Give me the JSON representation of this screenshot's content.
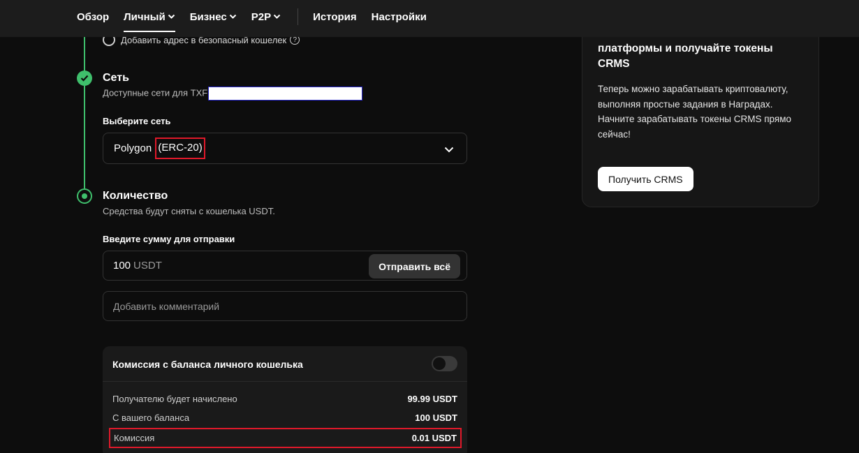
{
  "nav": {
    "items": [
      {
        "label": "Обзор",
        "dropdown": false,
        "active": false
      },
      {
        "label": "Личный",
        "dropdown": true,
        "active": true
      },
      {
        "label": "Бизнес",
        "dropdown": true,
        "active": false
      },
      {
        "label": "P2P",
        "dropdown": true,
        "active": false
      }
    ],
    "secondary": [
      {
        "label": "История"
      },
      {
        "label": "Настройки"
      }
    ]
  },
  "prev_option": {
    "label": "Добавить адрес в безопасный кошелек",
    "help": "?"
  },
  "network_step": {
    "title": "Сеть",
    "subtitle": "Доступные сети для TXF",
    "field_label": "Выберите сеть",
    "selected_network": "Polygon",
    "selected_standard": "(ERC-20)"
  },
  "amount_step": {
    "title": "Количество",
    "subtitle": "Средства будут сняты с кошелька USDT.",
    "field_label": "Введите сумму для отправки",
    "amount_value": "100",
    "amount_unit": "USDT",
    "send_all_label": "Отправить всё",
    "comment_placeholder": "Добавить комментарий"
  },
  "fee": {
    "title": "Комиссия с баланса личного кошелька",
    "toggle_on": false,
    "rows": [
      {
        "label": "Получателю будет начислено",
        "value": "99.99 USDT"
      },
      {
        "label": "С вашего баланса",
        "value": "100 USDT"
      },
      {
        "label": "Комиссия",
        "value": "0.01 USDT"
      }
    ]
  },
  "promo": {
    "title": "платформы и получайте токены CRMS",
    "text": "Теперь можно зарабатывать криптовалюту, выполняя простые задания в Наградах. Начните зарабатывать токены CRMS прямо сейчас!",
    "button_label": "Получить CRMS"
  },
  "colors": {
    "accent_green": "#3fbf6c",
    "highlight_red": "#e0192a",
    "background": "#0d0d0d"
  }
}
